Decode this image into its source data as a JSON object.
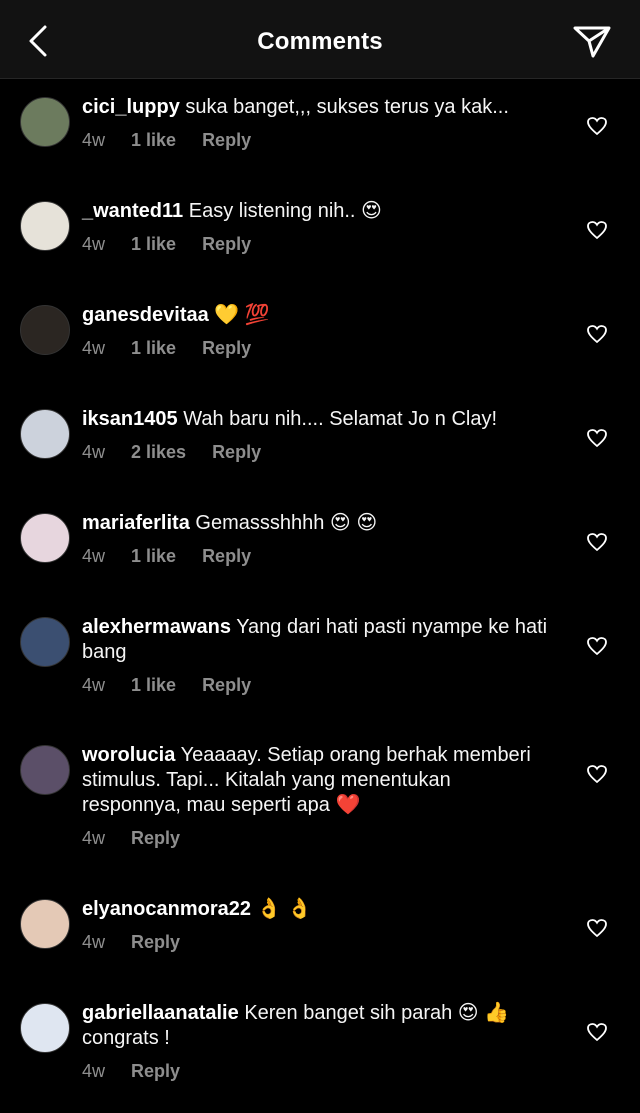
{
  "header": {
    "title": "Comments"
  },
  "comments": [
    {
      "username": "cici_luppy",
      "text": "suka banget,,, sukses terus ya kak...",
      "age": "4w",
      "likes": "1 like",
      "reply": "Reply",
      "avatar_color": "#6c7b5e"
    },
    {
      "username": "_wanted11",
      "text": "Easy listening nih.. 😍",
      "age": "4w",
      "likes": "1 like",
      "reply": "Reply",
      "avatar_color": "#e6e2d9"
    },
    {
      "username": "ganesdevitaa",
      "text": "💛 💯",
      "age": "4w",
      "likes": "1 like",
      "reply": "Reply",
      "avatar_color": "#2b2622"
    },
    {
      "username": "iksan1405",
      "text": "Wah baru nih.... Selamat Jo n Clay!",
      "age": "4w",
      "likes": "2 likes",
      "reply": "Reply",
      "avatar_color": "#ccd2dc"
    },
    {
      "username": "mariaferlita",
      "text": "Gemassshhhh 😍 😍",
      "age": "4w",
      "likes": "1 like",
      "reply": "Reply",
      "avatar_color": "#e7d6de"
    },
    {
      "username": "alexhermawans",
      "text": "Yang dari hati pasti nyampe ke hati bang",
      "age": "4w",
      "likes": "1 like",
      "reply": "Reply",
      "avatar_color": "#3b4f71"
    },
    {
      "username": "worolucia",
      "text": "Yeaaaay. Setiap orang berhak memberi stimulus. Tapi... Kitalah yang menentukan responnya, mau seperti apa ❤️",
      "age": "4w",
      "likes": "",
      "reply": "Reply",
      "avatar_color": "#5b4f68"
    },
    {
      "username": "elyanocanmora22",
      "text": "👌 👌",
      "age": "4w",
      "likes": "",
      "reply": "Reply",
      "avatar_color": "#e4c9b6"
    },
    {
      "username": "gabriellaanatalie",
      "text": "Keren banget sih parah 😍 👍 congrats !",
      "age": "4w",
      "likes": "",
      "reply": "Reply",
      "avatar_color": "#dfe6f1"
    }
  ]
}
